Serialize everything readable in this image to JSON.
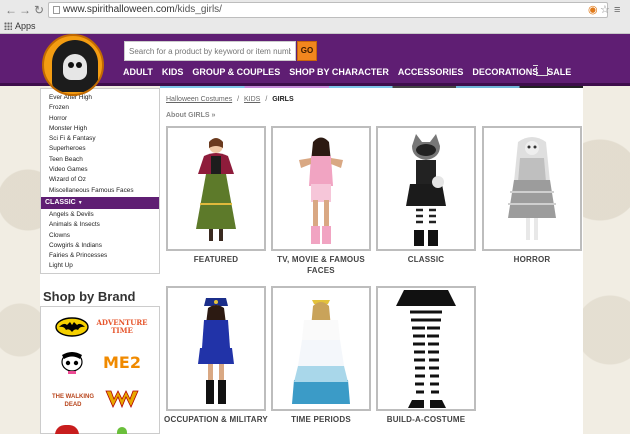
{
  "browser": {
    "url_prefix": "www.spirithalloween.com",
    "url_path": "/kids_girls/",
    "bookmarks_label": "Apps"
  },
  "header": {
    "search_placeholder": "Search for a product by keyword or item number",
    "go_label": "GO",
    "nav": [
      "ADULT",
      "KIDS",
      "GROUP & COUPLES",
      "SHOP BY CHARACTER",
      "ACCESSORIES",
      "DECORATIONS",
      "SALE"
    ]
  },
  "sidebar": {
    "tv_items": [
      "Ever After High",
      "Frozen",
      "Horror",
      "Monster High",
      "Sci Fi & Fantasy",
      "Superheroes",
      "Teen Beach",
      "Video Games",
      "Wizard of Oz",
      "Miscellaneous Famous Faces"
    ],
    "classic_header": "CLASSIC",
    "classic_items": [
      "Angels & Devils",
      "Animals & Insects",
      "Clowns",
      "Cowgirls & Indians",
      "Fairies & Princesses",
      "Light Up"
    ],
    "brand_title": "Shop by Brand",
    "brands": [
      "BATMAN",
      "ADVENTURE TIME",
      "MONSTER HIGH",
      "ME2",
      "THE WALKING DEAD",
      "WONDER WOMAN"
    ]
  },
  "breadcrumb": {
    "home": "Halloween Costumes",
    "kids": "KIDS",
    "current": "GIRLS",
    "sep": "/"
  },
  "about_link": "About GIRLS »",
  "categories": [
    {
      "label": "FEATURED"
    },
    {
      "label": "TV, MOVIE & FAMOUS FACES"
    },
    {
      "label": "CLASSIC"
    },
    {
      "label": "HORROR"
    },
    {
      "label": "OCCUPATION & MILITARY"
    },
    {
      "label": "TIME PERIODS"
    },
    {
      "label": "BUILD-A-COSTUME"
    }
  ],
  "colors": {
    "brand_purple": "#5f1e73",
    "go_orange": "#f2861e"
  }
}
